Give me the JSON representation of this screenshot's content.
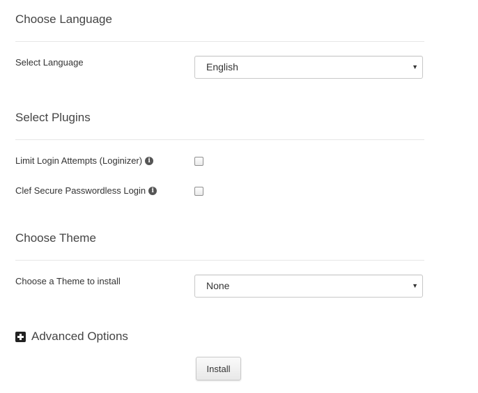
{
  "language_section": {
    "title": "Choose Language",
    "select_label": "Select Language",
    "selected_value": "English"
  },
  "plugins_section": {
    "title": "Select Plugins",
    "plugins": [
      {
        "label": "Limit Login Attempts (Loginizer)",
        "checked": false,
        "info_icon": "info-icon"
      },
      {
        "label": "Clef Secure Passwordless Login",
        "checked": false,
        "info_icon": "info-icon"
      }
    ]
  },
  "theme_section": {
    "title": "Choose Theme",
    "select_label": "Choose a Theme to install",
    "selected_value": "None"
  },
  "advanced": {
    "label": "Advanced Options",
    "icon": "plus-square-icon"
  },
  "install_button": "Install",
  "dropdown_caret": "▼",
  "info_glyph": "i"
}
